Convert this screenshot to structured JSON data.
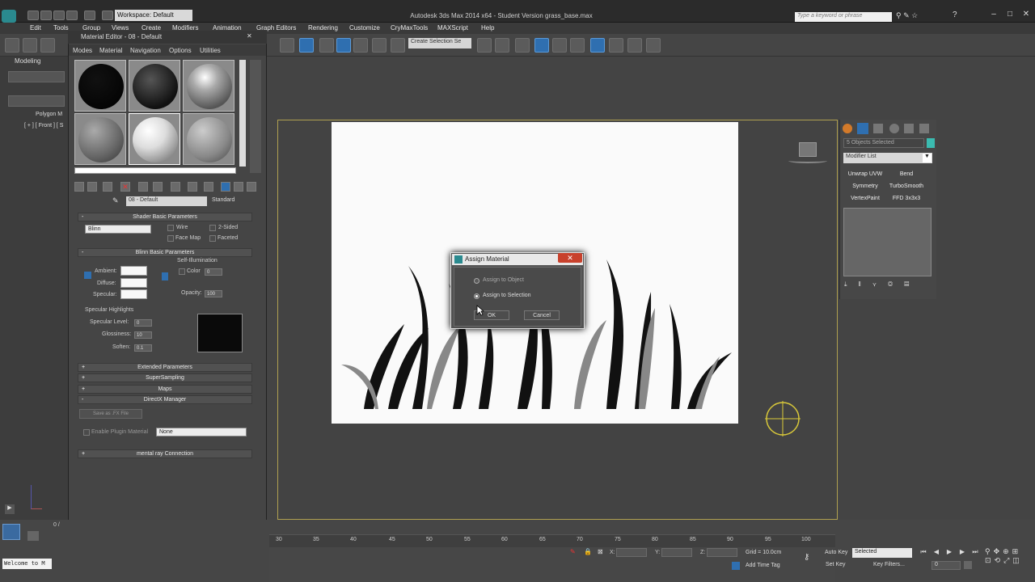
{
  "window": {
    "title": "Autodesk 3ds Max 2014 x64 - Student Version   grass_base.max",
    "workspace": "Workspace: Default",
    "search_placeholder": "Type a keyword or phrase"
  },
  "menus": [
    "Edit",
    "Tools",
    "Group",
    "Views",
    "Create",
    "Modifiers",
    "Animation",
    "Graph Editors",
    "Rendering",
    "Customize",
    "CryMaxTools",
    "MAXScript",
    "Help"
  ],
  "toolbar": {
    "selection_set": "Create Selection Se"
  },
  "ribbon": {
    "tab": "Modeling",
    "group": "Polygon M"
  },
  "viewport": {
    "label": "[ + ] [ Front ] [ S"
  },
  "material_editor": {
    "title": "Material Editor - 08 - Default",
    "menus": [
      "Modes",
      "Material",
      "Navigation",
      "Options",
      "Utilities"
    ],
    "material_name": "08 - Default",
    "material_type": "Standard",
    "shader_rollout": "Shader Basic Parameters",
    "shader": "Blinn",
    "wire": "Wire",
    "two_sided": "2-Sided",
    "face_map": "Face Map",
    "faceted": "Faceted",
    "blinn_rollout": "Blinn Basic Parameters",
    "self_illum": "Self-Illumination",
    "ambient": "Ambient:",
    "diffuse": "Diffuse:",
    "specular": "Specular:",
    "color": "Color",
    "color_val": "0",
    "opacity": "Opacity:",
    "opacity_val": "100",
    "spec_highlights": "Specular Highlights",
    "spec_level": "Specular Level:",
    "spec_level_val": "0",
    "glossiness": "Glossiness:",
    "glossiness_val": "10",
    "soften": "Soften:",
    "soften_val": "0.1",
    "extended": "Extended Parameters",
    "supersampling": "SuperSampling",
    "maps": "Maps",
    "directx": "DirectX Manager",
    "save_fx": "Save as .FX File",
    "enable_plugin": "Enable Plugin Material",
    "plugin_none": "None",
    "mental_ray": "mental ray Connection"
  },
  "command_panel": {
    "objects_selected": "5 Objects Selected",
    "modifier_list": "Modifier List",
    "buttons": [
      "Unwrap UVW",
      "Bend",
      "Symmetry",
      "TurboSmooth",
      "VertexPaint",
      "FFD 3x3x3"
    ],
    "object_color": "#3bbbb0"
  },
  "dialog": {
    "title": "Assign Material",
    "option1": "Assign to Object",
    "option2": "Assign to Selection",
    "selected": "Assign to Selection",
    "ok": "OK",
    "cancel": "Cancel"
  },
  "timeline": {
    "ticks": [
      "30",
      "35",
      "40",
      "45",
      "50",
      "55",
      "60",
      "65",
      "70",
      "75",
      "80",
      "85",
      "90",
      "95",
      "100"
    ],
    "frame_slider": "0 /"
  },
  "status": {
    "x_label": "X:",
    "y_label": "Y:",
    "z_label": "Z:",
    "grid": "Grid = 10.0cm",
    "add_time_tag": "Add Time Tag",
    "auto_key": "Auto Key",
    "set_key": "Set Key",
    "key_mode": "Selected",
    "key_filters": "Key Filters...",
    "frame": "0",
    "listener": "Welcome to M"
  }
}
